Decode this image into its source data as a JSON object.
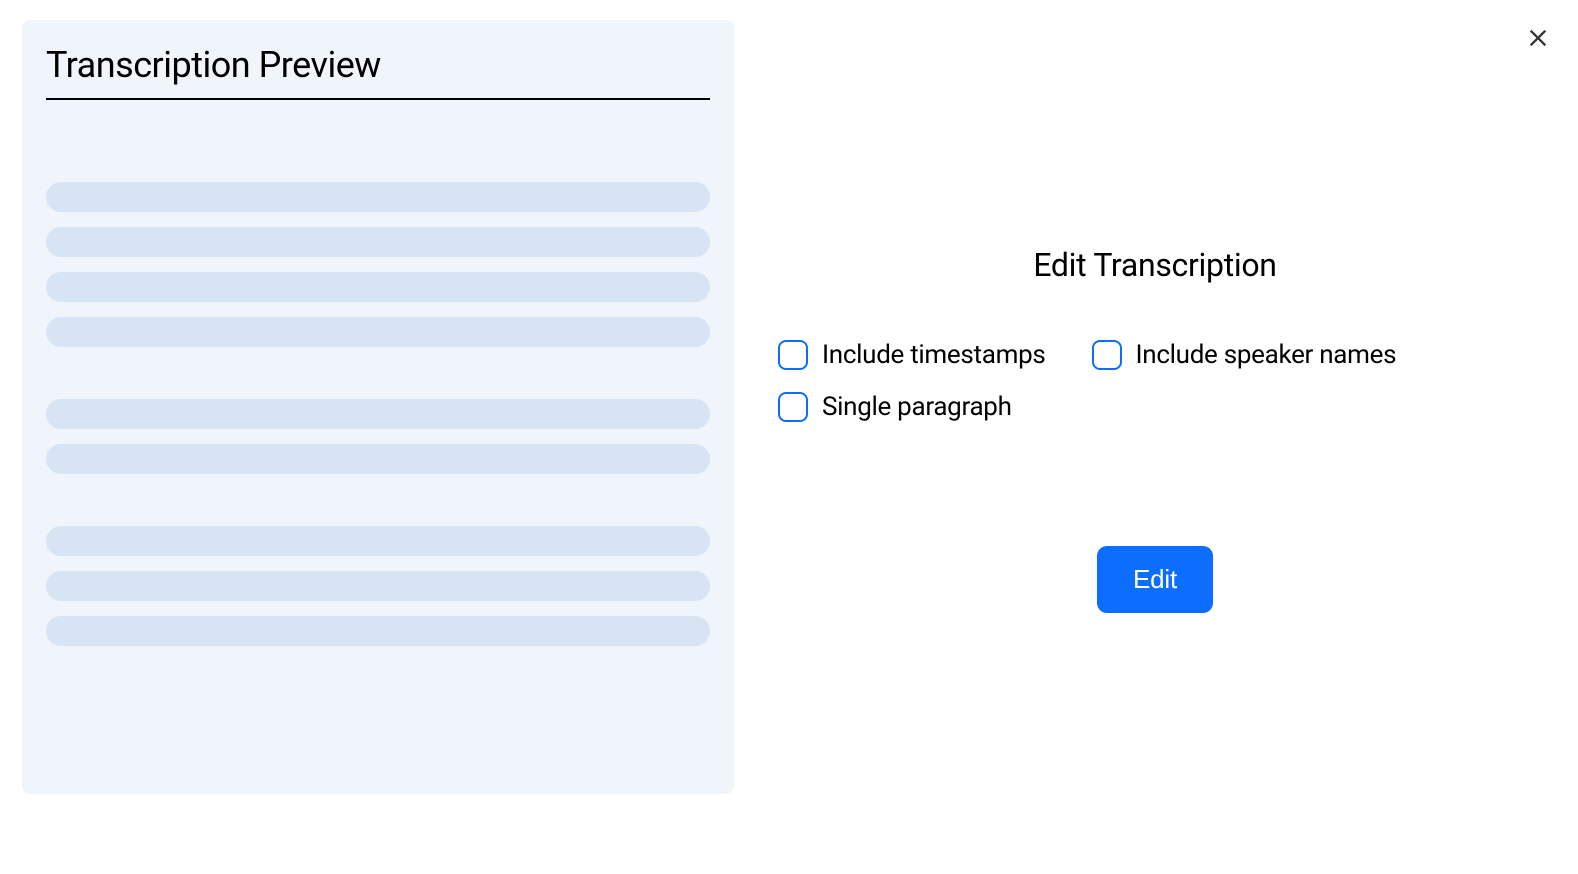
{
  "preview": {
    "title": "Transcription Preview"
  },
  "edit": {
    "title": "Edit Transcription",
    "options": {
      "timestamps": "Include timestamps",
      "speakers": "Include speaker names",
      "single_paragraph": "Single paragraph"
    },
    "button_label": "Edit"
  },
  "close_icon_name": "close-icon"
}
